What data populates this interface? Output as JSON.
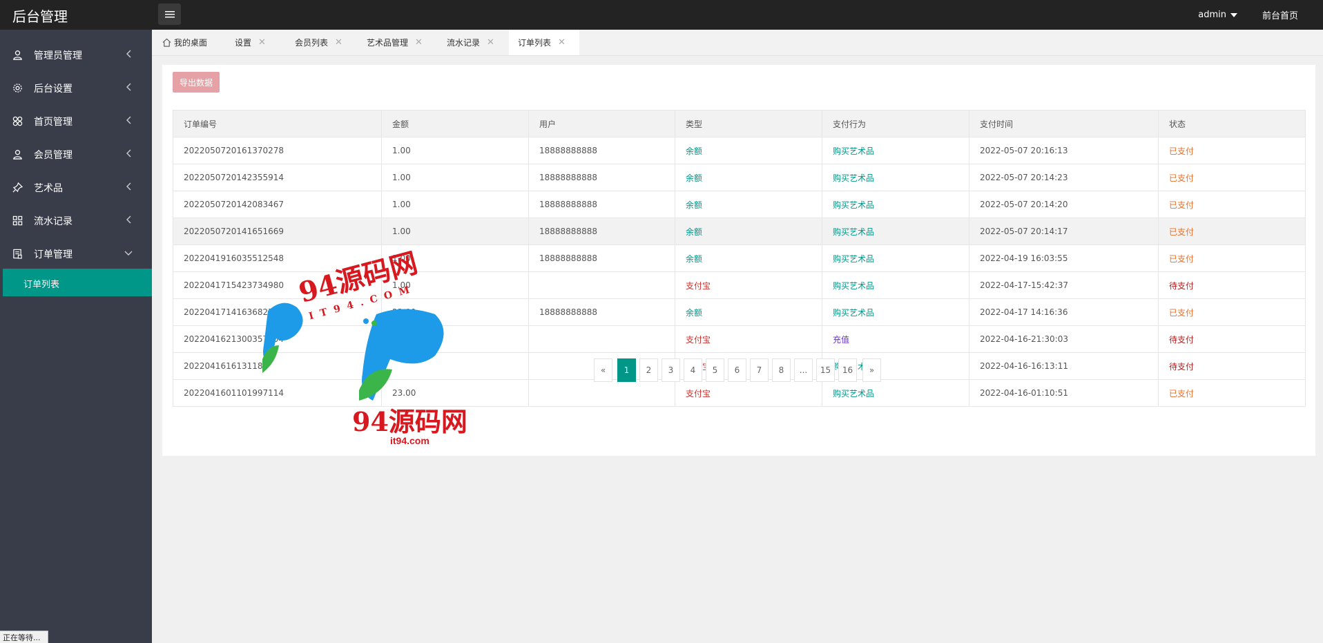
{
  "topbar": {
    "app_title": "后台管理",
    "user": "admin",
    "front_link": "前台首页"
  },
  "sidebar": {
    "items": [
      {
        "label": "管理员管理",
        "icon": "user-icon"
      },
      {
        "label": "后台设置",
        "icon": "gear-icon"
      },
      {
        "label": "首页管理",
        "icon": "grid-icon"
      },
      {
        "label": "会员管理",
        "icon": "user-icon"
      },
      {
        "label": "艺术品",
        "icon": "pin-icon"
      },
      {
        "label": "流水记录",
        "icon": "grid-icon"
      },
      {
        "label": "订单管理",
        "icon": "document-icon"
      }
    ],
    "active_sub": "订单列表"
  },
  "tabs": [
    {
      "label": "我的桌面"
    },
    {
      "label": "设置"
    },
    {
      "label": "会员列表"
    },
    {
      "label": "艺术品管理"
    },
    {
      "label": "流水记录"
    },
    {
      "label": "订单列表"
    }
  ],
  "toolbar": {
    "export_label": "导出数据"
  },
  "table": {
    "headers": [
      "订单编号",
      "金额",
      "用户",
      "类型",
      "支付行为",
      "支付时间",
      "状态"
    ],
    "rows": [
      [
        "2022050720161370278",
        "1.00",
        "18888888888",
        "余额",
        "购买艺术品",
        "2022-05-07 20:16:13",
        "已支付"
      ],
      [
        "2022050720142355914",
        "1.00",
        "18888888888",
        "余额",
        "购买艺术品",
        "2022-05-07 20:14:23",
        "已支付"
      ],
      [
        "2022050720142083467",
        "1.00",
        "18888888888",
        "余额",
        "购买艺术品",
        "2022-05-07 20:14:20",
        "已支付"
      ],
      [
        "2022050720141651669",
        "1.00",
        "18888888888",
        "余额",
        "购买艺术品",
        "2022-05-07 20:14:17",
        "已支付"
      ],
      [
        "2022041916035512548",
        "1.00",
        "18888888888",
        "余额",
        "购买艺术品",
        "2022-04-19 16:03:55",
        "已支付"
      ],
      [
        "2022041715423734980",
        "1.00",
        "",
        "支付宝",
        "购买艺术品",
        "2022-04-17-15:42:37",
        "待支付"
      ],
      [
        "2022041714163682721",
        "23.00",
        "18888888888",
        "余额",
        "购买艺术品",
        "2022-04-17 14:16:36",
        "已支付"
      ],
      [
        "2022041621300357004",
        "1.00",
        "",
        "支付宝",
        "充值",
        "2022-04-16-21:30:03",
        "待支付"
      ],
      [
        "2022041616131185",
        "",
        "",
        "支付宝",
        "购买艺术品",
        "2022-04-16-16:13:11",
        "待支付"
      ],
      [
        "2022041601101997114",
        "23.00",
        "",
        "支付宝",
        "购买艺术品",
        "2022-04-16-01:10:51",
        "已支付"
      ]
    ]
  },
  "pagination": {
    "prev": "«",
    "pages": [
      "1",
      "2",
      "3",
      "4",
      "5",
      "6",
      "7",
      "8",
      "...",
      "15",
      "16"
    ],
    "next": "»",
    "current": "1"
  },
  "status_bar": "正在等待...",
  "watermark": {
    "text1": "94源码网",
    "text2": "IT94.COM",
    "text3": "94源码网",
    "text4": "it94.com"
  },
  "colors": {
    "accent": "#009688",
    "sidebar_bg": "#393d49",
    "topbar_bg": "#232323",
    "export_button": "#e6a1a6",
    "paid": "#e8702a",
    "pending": "#b01c1c",
    "balance": "#009688",
    "alipay": "#c9302c"
  }
}
